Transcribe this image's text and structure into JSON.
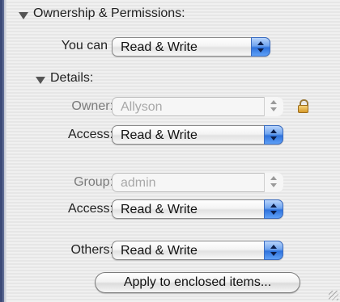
{
  "section": {
    "title": "Ownership & Permissions:",
    "you_can": {
      "label": "You can",
      "value": "Read & Write"
    },
    "details": {
      "title": "Details:",
      "owner": {
        "label": "Owner:",
        "value": "Allyson",
        "disabled": true
      },
      "owner_access": {
        "label": "Access:",
        "value": "Read & Write"
      },
      "group": {
        "label": "Group:",
        "value": "admin",
        "disabled": true
      },
      "group_access": {
        "label": "Access:",
        "value": "Read & Write"
      },
      "others": {
        "label": "Others:",
        "value": "Read & Write"
      }
    },
    "apply_button": "Apply to enclosed items..."
  },
  "icons": [
    "disclosure-triangle-icon",
    "lock-icon",
    "popup-arrows-icon",
    "resize-grip-icon"
  ],
  "colors": {
    "aqua_blue": "#2f72dc",
    "lock_gold": "#d79a2a",
    "window_edge": "#3c4a78"
  }
}
